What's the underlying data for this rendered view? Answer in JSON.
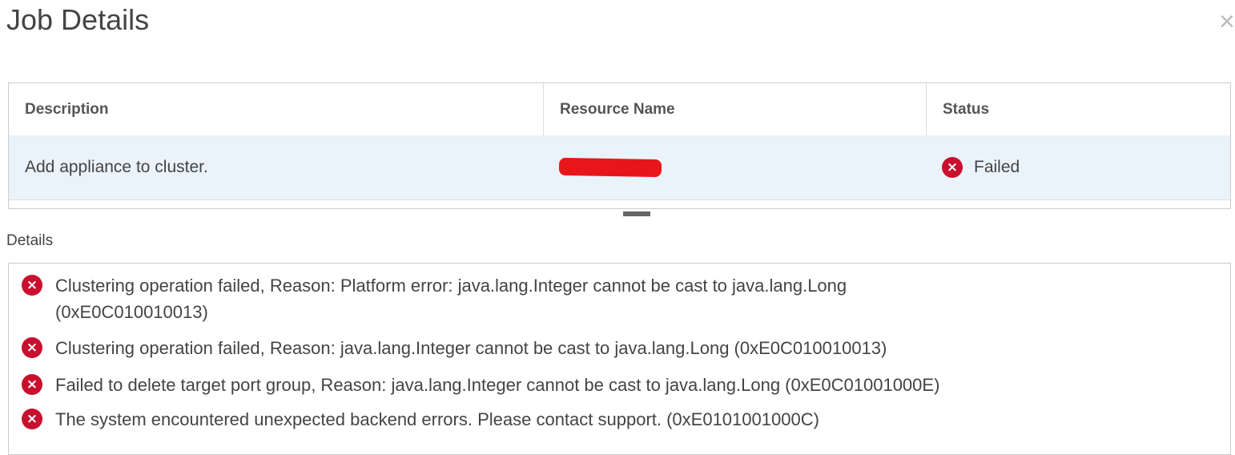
{
  "dialog": {
    "title": "Job Details",
    "close_label": "×"
  },
  "table": {
    "headers": [
      "Description",
      "Resource Name",
      "Status"
    ],
    "rows": [
      {
        "description": "Add appliance to cluster.",
        "resource_name_redacted": true,
        "status": "Failed"
      }
    ]
  },
  "details": {
    "label": "Details",
    "messages": [
      "Clustering operation failed, Reason: Platform error: java.lang.Integer cannot be cast to java.lang.Long (0xE0C010010013)",
      "Clustering operation failed, Reason: java.lang.Integer cannot be cast to java.lang.Long (0xE0C010010013)",
      "Failed to delete target port group, Reason: java.lang.Integer cannot be cast to java.lang.Long (0xE0C01001000E)",
      "The system encountered unexpected backend errors. Please contact support. (0xE0101001000C)"
    ]
  },
  "icons": {
    "error": "×"
  },
  "colors": {
    "error": "#c8102e",
    "selected_row": "#eaf3fa"
  }
}
